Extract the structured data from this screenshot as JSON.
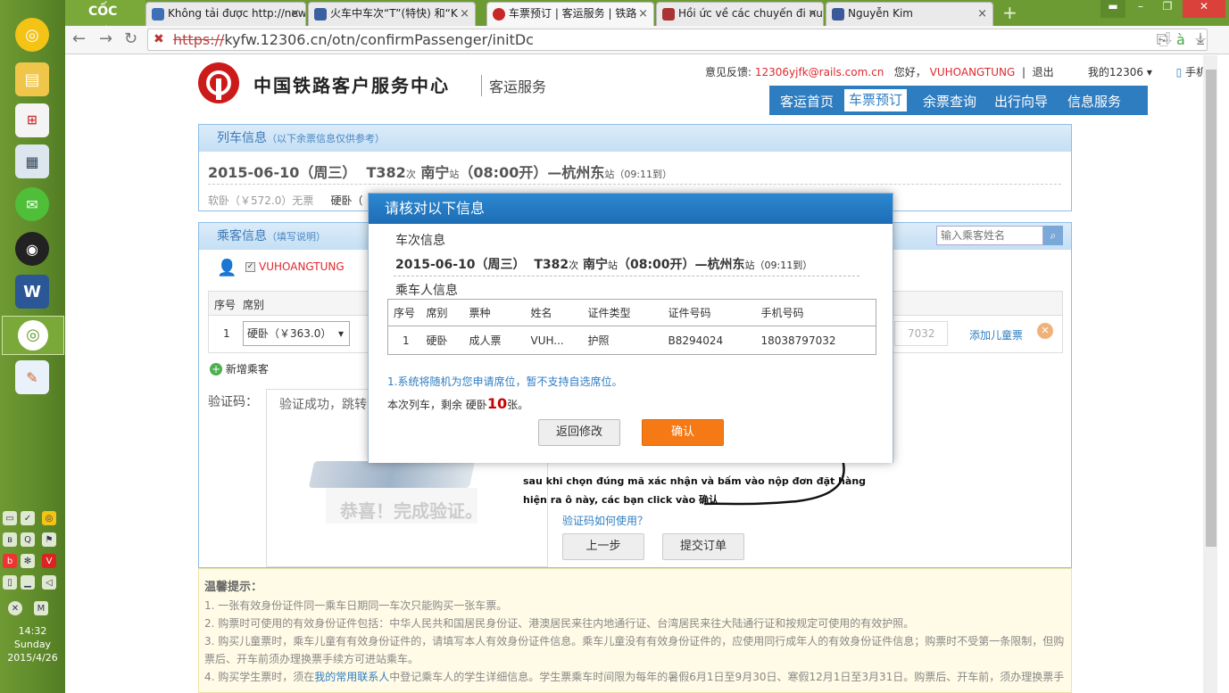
{
  "browser": {
    "brand": "CỐC CỐC",
    "tabs": [
      {
        "label": "Không tải được http://new",
        "close": "×"
      },
      {
        "label": "火车中车次“T”(特快) 和“K",
        "close": "×"
      },
      {
        "label": "车票预订 | 客运服务 | 铁路",
        "close": "×"
      },
      {
        "label": "Hồi ức về các chuyến đi nu",
        "close": "×"
      },
      {
        "label": "Nguyễn Kim",
        "close": "×"
      }
    ],
    "new_tab": "+",
    "url_scheme": "https://",
    "url_rest": "kyfw.12306.cn/otn/confirmPassenger/initDc"
  },
  "system": {
    "time": "14:32",
    "day": "Sunday",
    "date": "2015/4/26"
  },
  "site": {
    "title": "中国铁路客户服务中心",
    "subtitle": "客运服务",
    "feedback_label": "意见反馈:",
    "feedback_email": "12306yjfk@rails.com.cn",
    "greeting": "您好，",
    "username": "VUHOANGTUNG",
    "logout": "退出",
    "my12306": "我的12306",
    "mobile": "手机版",
    "nav": [
      "客运首页",
      "车票预订",
      "余票查询",
      "出行向导",
      "信息服务"
    ]
  },
  "train_panel": {
    "title": "列车信息",
    "title_note": "（以下余票信息仅供参考）",
    "date": "2015-06-10（周三）",
    "train_no": "T382",
    "ci": "次",
    "from": "南宁",
    "zhan": "站",
    "depart": "（08:00开）",
    "dash": "—",
    "to": "杭州东",
    "arrive": "（09:11到）",
    "seat1": "软卧（￥572.0）无票",
    "seat2": "硬卧（"
  },
  "passenger_panel": {
    "title": "乘客信息",
    "title_note": "（填写说明）",
    "search_placeholder": "输入乘客姓名",
    "contact": "VUHOANGTUNG",
    "cols": [
      "序号",
      "席别"
    ],
    "row_no": "1",
    "seat_select": "硬卧（￥363.0）",
    "phone_partial": "7032",
    "add_child": "添加儿童票",
    "add_passenger": "新增乘客"
  },
  "captcha": {
    "label": "验证码：",
    "status": "验证成功，跳转",
    "success": "恭喜！完成验证。",
    "help": "验证码如何使用？",
    "prev": "上一步",
    "submit": "提交订单"
  },
  "annotation": {
    "line1": "sau khi chọn đúng mã xác nhận và bấm vào nộp đơn đặt hàng",
    "line2": "hiện ra ô này, các bạn click vào 确认"
  },
  "modal": {
    "title": "请核对以下信息",
    "section1": "车次信息",
    "date": "2015-06-10（周三）",
    "train_no": "T382",
    "ci": "次",
    "from": "南宁",
    "zhan": "站",
    "depart": "（08:00开）—",
    "to": "杭州东",
    "arrive": "（09:11到）",
    "section2": "乘车人信息",
    "headers": [
      "序号",
      "席别",
      "票种",
      "姓名",
      "证件类型",
      "证件号码",
      "手机号码"
    ],
    "row": [
      "1",
      "硬卧",
      "成人票",
      "VUH...",
      "护照",
      "B8294024",
      "18038797032"
    ],
    "notice": "1.系统将随机为您申请席位，暂不支持自选席位。",
    "remain_prefix": "本次列车，剩余 硬卧",
    "remain_count": "10",
    "remain_suffix": "张。",
    "back_btn": "返回修改",
    "ok_btn": "确认"
  },
  "tips": {
    "title": "温馨提示：",
    "items": [
      "1. 一张有效身份证件同一乘车日期同一车次只能购买一张车票。",
      "2. 购票时可使用的有效身份证件包括：中华人民共和国居民身份证、港澳居民来往内地通行证、台湾居民来往大陆通行证和按规定可使用的有效护照。",
      "3. 购买儿童票时，乘车儿童有有效身份证件的，请填写本人有效身份证件信息。乘车儿童没有有效身份证件的，应使用同行成年人的有效身份证件信息；购票时不受第一条限制，但购",
      "票后、开车前须办理换票手续方可进站乘车。",
      "4. 购买学生票时，须在",
      "我的常用联系人",
      "中登记乘车人的学生详细信息。学生票乘车时间限为每年的暑假6月1日至9月30日、寒假12月1日至3月31日。购票后、开车前，须办理换票手"
    ]
  }
}
